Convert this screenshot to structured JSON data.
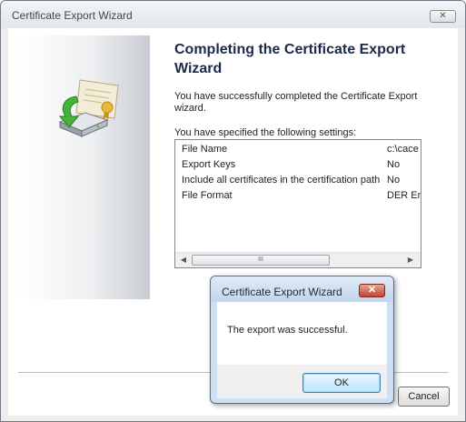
{
  "window": {
    "title": "Certificate Export Wizard",
    "close_glyph": "✕"
  },
  "wizard": {
    "heading": "Completing the Certificate Export Wizard",
    "success_text": "You have successfully completed the Certificate Export wizard.",
    "settings_label": "You have specified the following settings:",
    "settings": [
      {
        "key": "File Name",
        "value": "c:\\cace"
      },
      {
        "key": "Export Keys",
        "value": "No"
      },
      {
        "key": "Include all certificates in the certification path",
        "value": "No"
      },
      {
        "key": "File Format",
        "value": "DER En"
      }
    ],
    "scroll_left": "◀",
    "scroll_right": "▶",
    "scroll_grip": "III",
    "cancel_label": "Cancel"
  },
  "dialog": {
    "title": "Certificate Export Wizard",
    "close_glyph": "✕",
    "message": "The export was successful.",
    "ok_label": "OK"
  },
  "icons": {
    "side_graphic": "certificate-export-icon"
  },
  "colors": {
    "heading": "#1b2a4a",
    "dialog_close": "#c4442f",
    "ok_border": "#3c7fb1"
  }
}
